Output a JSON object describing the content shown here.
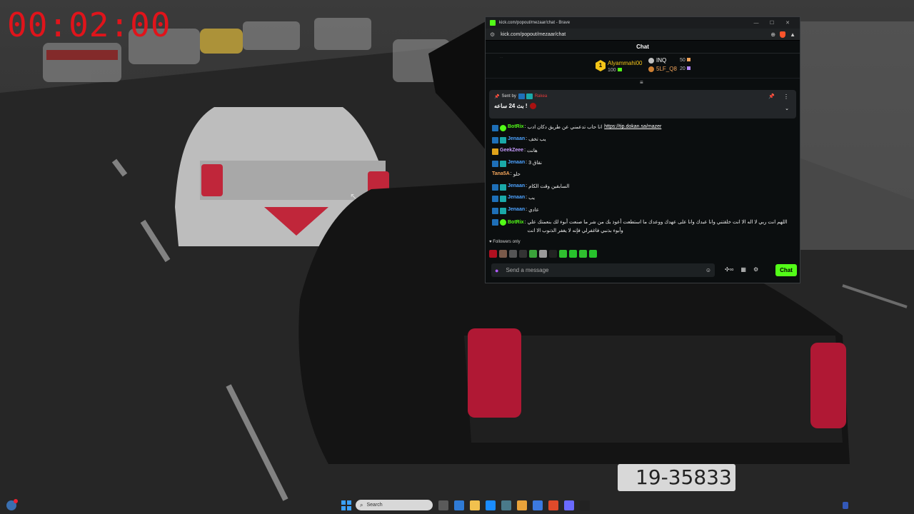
{
  "overlay": {
    "timer": "00:02:00"
  },
  "browser": {
    "title": "kick.com/popout/mezaar/chat - Brave",
    "url": "kick.com/popout/mezaar/chat"
  },
  "chat": {
    "header": "Chat",
    "faded_line": "...",
    "leaderboard": {
      "top": {
        "name": "Alyammahi00",
        "count": "100",
        "badge": "1"
      },
      "others": [
        {
          "name": "INQ",
          "value": "50",
          "medal_color": "#c0c0c0",
          "square_color": "#f0a35a"
        },
        {
          "name": "5LF_Q8",
          "value": "20",
          "medal_color": "#cd7f32",
          "square_color": "#b488ff"
        }
      ]
    },
    "pinned": {
      "sent_by_label": "Sent by",
      "sender": "Rakea",
      "text": "بث 24 ساعه !"
    },
    "messages": [
      {
        "user": "BotRix",
        "user_class": "u-bot",
        "badges": [
          "b-kick",
          "b-verified"
        ],
        "text": "انا حاب تدعمني عن طريق دكان ادب",
        "link": "https://tip.dokan.sa/mazer"
      },
      {
        "user": "Jenaan",
        "user_class": "u-jen",
        "badges": [
          "b-kick",
          "b-sub"
        ],
        "text": "يب تخف"
      },
      {
        "user": "GeekZeee",
        "user_class": "u-geek",
        "badges": [
          "b-gold"
        ],
        "text": "هانت"
      },
      {
        "user": "Jenaan",
        "user_class": "u-jen",
        "badges": [
          "b-kick",
          "b-sub"
        ],
        "text": "نقاق 3"
      },
      {
        "user": "Tana5A",
        "user_class": "u-tana",
        "badges": [],
        "text": "حلو"
      },
      {
        "user": "Jenaan",
        "user_class": "u-jen",
        "badges": [
          "b-kick",
          "b-sub"
        ],
        "text": "السابقين وقت الكام"
      },
      {
        "user": "Jenaan",
        "user_class": "u-jen",
        "badges": [
          "b-kick",
          "b-sub"
        ],
        "text": "يب"
      },
      {
        "user": "Jenaan",
        "user_class": "u-jen",
        "badges": [
          "b-kick",
          "b-sub"
        ],
        "text": "عادي"
      },
      {
        "user": "BotRix",
        "user_class": "u-bot",
        "badges": [
          "b-kick",
          "b-verified"
        ],
        "text": "اللهم انت ربي لا اله الا انت خلقتني وانا عبدك وانا على عهدك ووعدك ما استطعت أعوذ بك من شر ما صنعت أبوء لك بنعمتك علي وأبوء بذنبي فاغفرلي فإنه لا يغفر الذنوب الا انت",
        "multi": true
      }
    ],
    "followers_label": "Followers only",
    "emote_colors": [
      "#b01020",
      "#7a5a4a",
      "#555",
      "#333",
      "#3aa33a",
      "#999",
      "#222",
      "#2fbf2f",
      "#27c22c",
      "#2fbf2f",
      "#27c22c"
    ],
    "input_placeholder": "Send a message",
    "send_label": "Chat",
    "colors": {
      "accent": "#53fc18",
      "background": "#0b0e0f"
    }
  },
  "taskbar": {
    "search_label": "Search",
    "icon_colors": [
      "#5a5a5a",
      "#2f7bd6",
      "#f2c14e",
      "#1a8cff",
      "#4a7a8a",
      "#e8a23a",
      "#3c7ae0",
      "#e04a2a",
      "#6a6aff",
      "#222"
    ]
  }
}
